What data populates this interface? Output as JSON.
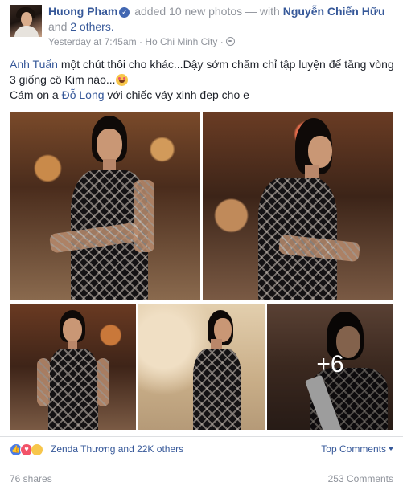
{
  "post": {
    "author": "Huong Pham",
    "verified_icon": "verified-check-icon",
    "action_text": "added 10 new photos — with",
    "tagged_person": "Nguyễn Chiến Hữu",
    "and_text": "and",
    "others_link": "2 others.",
    "timestamp": "Yesterday at 7:45am",
    "separator": "·",
    "location": "Ho Chi Minh City",
    "privacy_dot": "·",
    "privacy_icon": "globe-icon",
    "text": {
      "mention_1": "Anh Tuấn",
      "line_1": "một chút thôi cho khác...Dậy sớm chăm chỉ tập luyện để tăng vòng 3 giống cô Kim nào...",
      "line_2_prefix": "Cám on a",
      "mention_2": "Đỗ Long",
      "line_2_suffix": "với chiếc váy xinh đẹp cho e"
    },
    "photos": {
      "more_count": "+6"
    },
    "reactions": {
      "icons": [
        "like-icon",
        "love-icon",
        "haha-icon"
      ],
      "summary": "Zenda Thương and 22K others",
      "sort_label": "Top Comments"
    },
    "footer": {
      "shares": "76 shares",
      "comments": "253 Comments"
    },
    "colors": {
      "link": "#365899",
      "meta": "#90949c",
      "like": "#4a7ce8",
      "love": "#f25268",
      "haha": "#f7c64b"
    }
  }
}
